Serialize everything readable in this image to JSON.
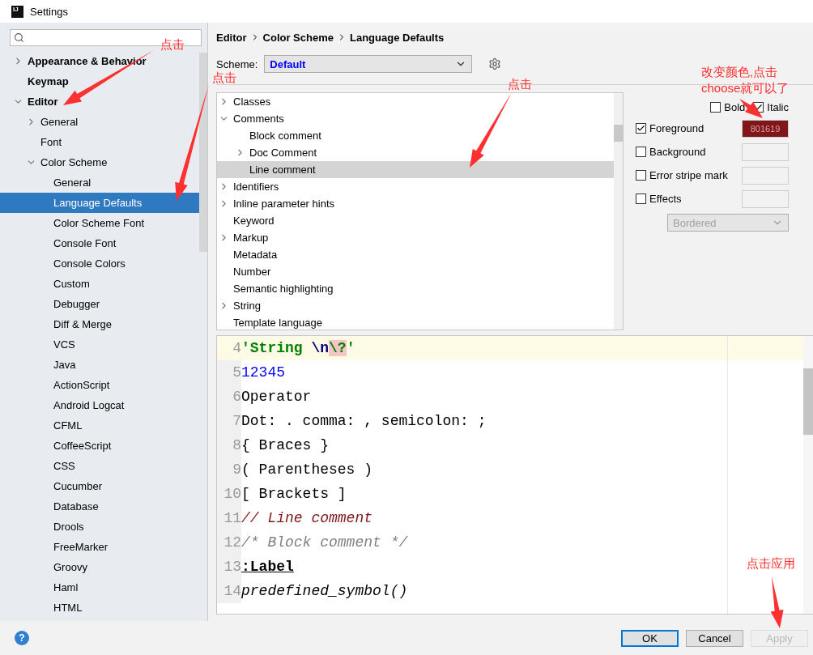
{
  "window": {
    "title": "Settings",
    "logo": "IJ"
  },
  "help": "?",
  "sidebar": {
    "items": [
      {
        "label": "Appearance & Behavior",
        "expanded": false,
        "selected": false
      },
      {
        "label": "Keymap",
        "selected": false
      },
      {
        "label": "Editor",
        "expanded": true,
        "selected": false,
        "children": [
          {
            "label": "General",
            "expanded": false,
            "selected": false
          },
          {
            "label": "Font",
            "selected": false
          },
          {
            "label": "Color Scheme",
            "expanded": true,
            "selected": false,
            "children": [
              {
                "label": "General",
                "selected": false
              },
              {
                "label": "Language Defaults",
                "selected": true
              },
              {
                "label": "Color Scheme Font",
                "selected": false
              },
              {
                "label": "Console Font",
                "selected": false
              },
              {
                "label": "Console Colors",
                "selected": false
              },
              {
                "label": "Custom",
                "selected": false
              },
              {
                "label": "Debugger",
                "selected": false
              },
              {
                "label": "Diff & Merge",
                "selected": false
              },
              {
                "label": "VCS",
                "selected": false
              },
              {
                "label": "Java",
                "selected": false
              },
              {
                "label": "ActionScript",
                "selected": false
              },
              {
                "label": "Android Logcat",
                "selected": false
              },
              {
                "label": "CFML",
                "selected": false
              },
              {
                "label": "CoffeeScript",
                "selected": false
              },
              {
                "label": "CSS",
                "selected": false
              },
              {
                "label": "Cucumber",
                "selected": false
              },
              {
                "label": "Database",
                "selected": false
              },
              {
                "label": "Drools",
                "selected": false
              },
              {
                "label": "FreeMarker",
                "selected": false
              },
              {
                "label": "Groovy",
                "selected": false
              },
              {
                "label": "Haml",
                "selected": false
              },
              {
                "label": "HTML",
                "selected": false
              }
            ]
          }
        ]
      }
    ]
  },
  "breadcrumb": [
    "Editor",
    "Color Scheme",
    "Language Defaults"
  ],
  "scheme": {
    "label": "Scheme:",
    "value": "Default"
  },
  "attributes": [
    {
      "label": "Classes",
      "expanded": false,
      "selected": false
    },
    {
      "label": "Comments",
      "expanded": true,
      "selected": false,
      "children": [
        {
          "label": "Block comment",
          "selected": false
        },
        {
          "label": "Doc Comment",
          "expanded": false,
          "selected": false
        },
        {
          "label": "Line comment",
          "selected": true
        }
      ]
    },
    {
      "label": "Identifiers",
      "expanded": false,
      "selected": false
    },
    {
      "label": "Inline parameter hints",
      "expanded": false,
      "selected": false
    },
    {
      "label": "Keyword",
      "selected": false
    },
    {
      "label": "Markup",
      "expanded": false,
      "selected": false
    },
    {
      "label": "Metadata",
      "selected": false
    },
    {
      "label": "Number",
      "selected": false
    },
    {
      "label": "Semantic highlighting",
      "selected": false
    },
    {
      "label": "String",
      "expanded": false,
      "selected": false
    },
    {
      "label": "Template language",
      "selected": false
    }
  ],
  "style_options": [
    {
      "label": "Bold",
      "checked": false
    },
    {
      "label": "Italic",
      "checked": true
    }
  ],
  "color_options": [
    {
      "label": "Foreground",
      "checked": true,
      "value": "801619",
      "color": "#801619"
    },
    {
      "label": "Background",
      "checked": false
    },
    {
      "label": "Error stripe mark",
      "checked": false
    },
    {
      "label": "Effects",
      "checked": false
    }
  ],
  "effect_type": {
    "value": "Bordered",
    "disabled": true
  },
  "preview": {
    "lines": [
      {
        "number": "4",
        "current": true,
        "tokens": [
          {
            "kind": "string",
            "text": "'String "
          },
          {
            "kind": "escape",
            "text": "\\n"
          },
          {
            "kind": "bad-escape",
            "text": "\\?"
          },
          {
            "kind": "string",
            "text": "'"
          }
        ]
      },
      {
        "number": "5",
        "tokens": [
          {
            "kind": "number",
            "text": "12345"
          }
        ]
      },
      {
        "number": "6",
        "tokens": [
          {
            "kind": "plain",
            "text": "Operator"
          }
        ]
      },
      {
        "number": "7",
        "tokens": [
          {
            "kind": "plain",
            "text": "Dot: . comma: , semicolon: ;"
          }
        ]
      },
      {
        "number": "8",
        "tokens": [
          {
            "kind": "plain",
            "text": "{ Braces }"
          }
        ]
      },
      {
        "number": "9",
        "tokens": [
          {
            "kind": "plain",
            "text": "( Parentheses )"
          }
        ]
      },
      {
        "number": "10",
        "tokens": [
          {
            "kind": "plain",
            "text": "[ Brackets ]"
          }
        ]
      },
      {
        "number": "11",
        "tokens": [
          {
            "kind": "line-comment",
            "text": "// Line comment"
          }
        ]
      },
      {
        "number": "12",
        "tokens": [
          {
            "kind": "block-comment",
            "text": "/* Block comment */"
          }
        ]
      },
      {
        "number": "13",
        "tokens": [
          {
            "kind": "label",
            "text": ":Label"
          }
        ]
      },
      {
        "number": "14",
        "tokens": [
          {
            "kind": "predefined",
            "text": "predefined_symbol()"
          }
        ]
      }
    ]
  },
  "buttons": [
    {
      "label": "OK",
      "default": true,
      "disabled": false
    },
    {
      "label": "Cancel",
      "default": false,
      "disabled": false
    },
    {
      "label": "Apply",
      "default": false,
      "disabled": true
    }
  ],
  "annotations": [
    {
      "text": "点击"
    },
    {
      "text": "点击"
    },
    {
      "text": "点击"
    },
    {
      "text": "改变颜色,点击"
    },
    {
      "text": "choose就可以了"
    },
    {
      "text": "点击应用"
    }
  ]
}
